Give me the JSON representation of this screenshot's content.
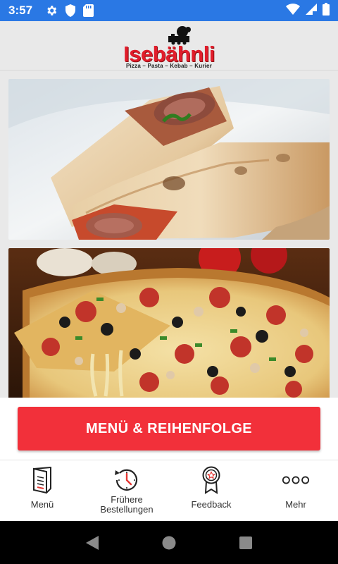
{
  "status_bar": {
    "time": "3:57",
    "left_icons": [
      "settings-icon",
      "shield-icon",
      "sd-card-icon"
    ],
    "right_icons": [
      "wifi-icon",
      "signal-icon",
      "battery-icon"
    ],
    "background_color": "#2a78e4"
  },
  "header": {
    "logo_text": "Isebähnli",
    "tagline": "Pizza – Pasta – Kebab – Kurier"
  },
  "images": [
    {
      "name": "kebab-wrap-image"
    },
    {
      "name": "pizza-image"
    }
  ],
  "cta": {
    "label": "MENÜ & REIHENFOLGE",
    "color": "#f2303a"
  },
  "bottom_nav": [
    {
      "id": "menu",
      "label": "Menü",
      "icon": "menu-book-icon"
    },
    {
      "id": "orders",
      "label": "Frühere Bestellungen",
      "line1": "Frühere",
      "line2": "Bestellungen",
      "icon": "history-icon"
    },
    {
      "id": "feedback",
      "label": "Feedback",
      "icon": "award-badge-icon"
    },
    {
      "id": "more",
      "label": "Mehr",
      "icon": "more-dots-icon"
    }
  ],
  "android_nav": [
    "back-icon",
    "home-icon",
    "recents-icon"
  ]
}
